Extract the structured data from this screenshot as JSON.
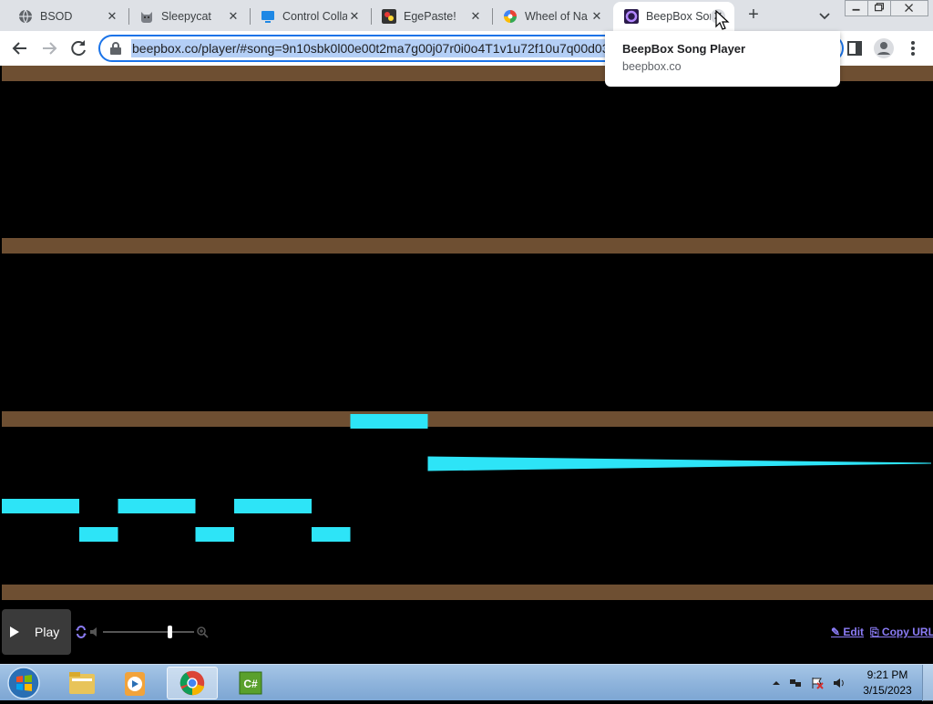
{
  "browser": {
    "tabs": [
      {
        "title": "BSOD",
        "favicon": "globe-icon",
        "active": false
      },
      {
        "title": "Sleepycat",
        "favicon": "cat-icon",
        "active": false
      },
      {
        "title": "Control Colla",
        "favicon": "monitor-icon",
        "active": false
      },
      {
        "title": "EgePaste!",
        "favicon": "egepaste-icon",
        "active": false
      },
      {
        "title": "Wheel of Na",
        "favicon": "wheel-icon",
        "active": false
      },
      {
        "title": "BeepBox Sor",
        "favicon": "beepbox-icon",
        "active": true
      }
    ],
    "new_tab_label": "+",
    "close_glyph": "✕",
    "url": "beepbox.co/player/#song=9n10sbk0l00e00t2ma7g00j07r0i0o4T1v1u72f10u7q00d03",
    "hover_card": {
      "title": "BeepBox Song Player",
      "domain": "beepbox.co"
    }
  },
  "player": {
    "play_label": "Play",
    "edit_label": "✎ Edit",
    "copy_url_label": "⎘ Copy URL",
    "playhead_position": 0.72,
    "colors": {
      "separator": "#6e4f32",
      "note": "#2de4f7",
      "background": "#000000",
      "link": "#8b7cf6"
    },
    "pianoroll": {
      "note_rows": [
        {
          "bar_start": 0,
          "bar_end": 1,
          "pitch": 2
        },
        {
          "bar_start": 1,
          "bar_end": 1.5,
          "pitch": 1
        },
        {
          "bar_start": 1.5,
          "bar_end": 2.5,
          "pitch": 2
        },
        {
          "bar_start": 2.5,
          "bar_end": 3,
          "pitch": 1
        },
        {
          "bar_start": 3,
          "bar_end": 4,
          "pitch": 2
        },
        {
          "bar_start": 4,
          "bar_end": 4.5,
          "pitch": 1
        },
        {
          "bar_start": 4.5,
          "bar_end": 5.5,
          "pitch": 5
        }
      ],
      "slide_note": {
        "bar_start": 5.5,
        "bar_end": 12,
        "pitch": 3.5
      }
    }
  },
  "taskbar": {
    "apps": [
      {
        "name": "explorer-icon",
        "active": false
      },
      {
        "name": "media-player-icon",
        "active": false
      },
      {
        "name": "chrome-icon",
        "active": true
      },
      {
        "name": "csharp-icon",
        "active": false
      }
    ],
    "clock": {
      "time": "9:21 PM",
      "date": "3/15/2023"
    }
  }
}
